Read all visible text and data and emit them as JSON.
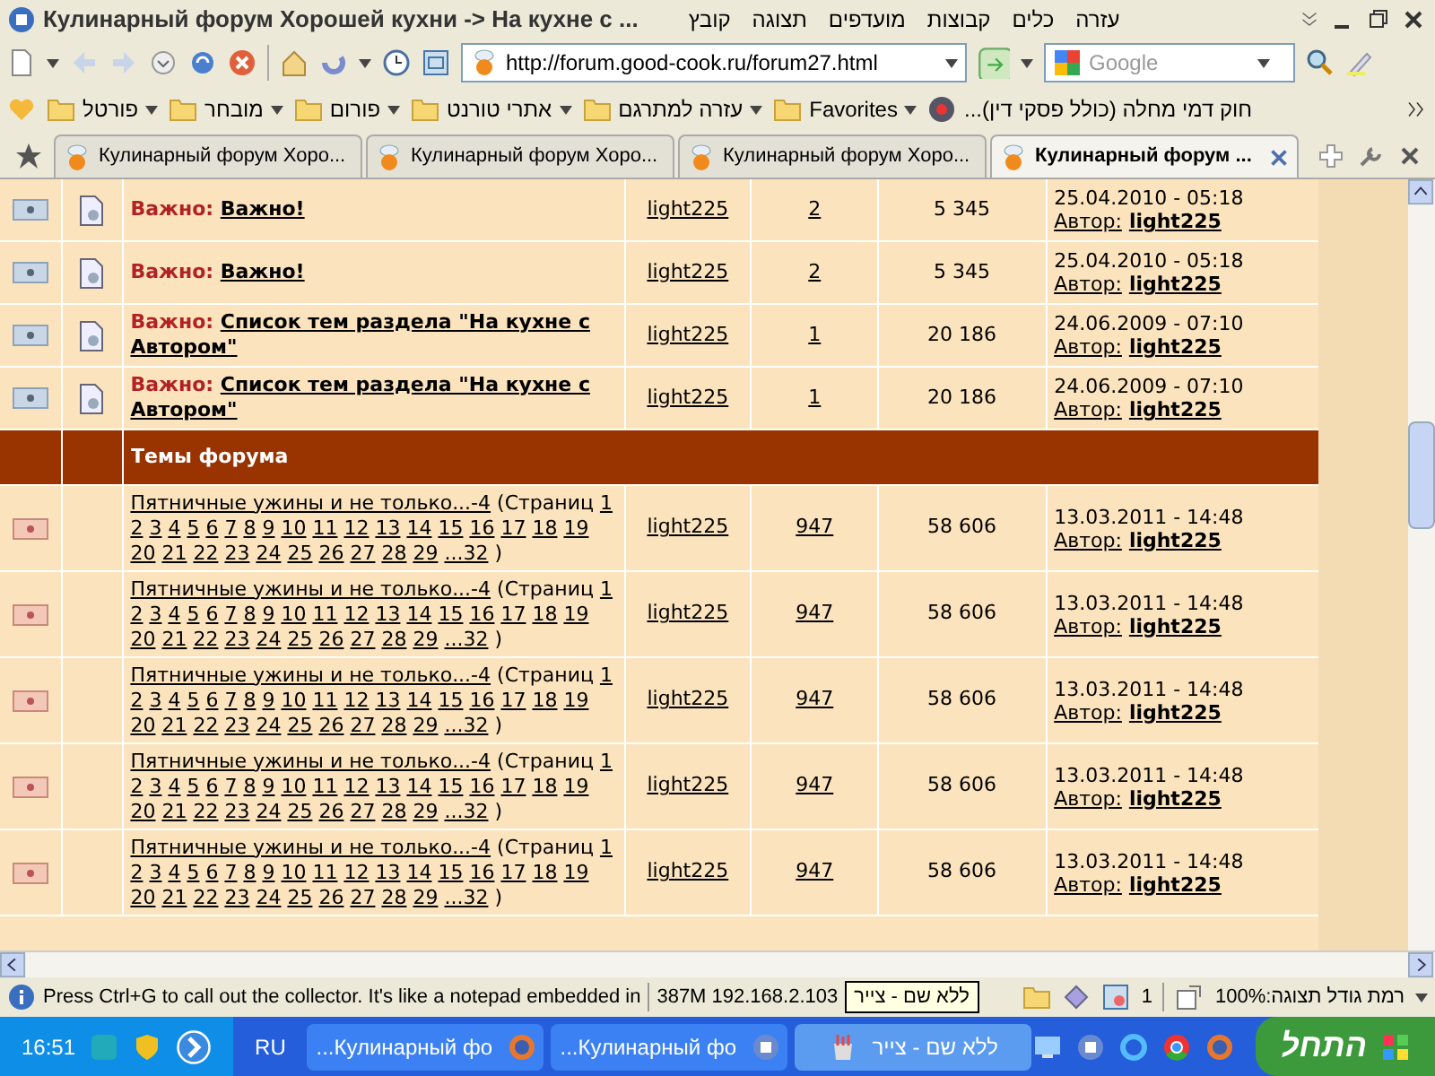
{
  "window": {
    "title": "Кулинарный форум Хорошей кухни -> На кухне с ..."
  },
  "menu": [
    "עזרה",
    "כלים",
    "קבוצות",
    "מועדפים",
    "תצוגה",
    "קובץ"
  ],
  "toolbar": {
    "address": "http://forum.good-cook.ru/forum27.html",
    "search_placeholder": "Google"
  },
  "bookmarks": [
    {
      "label": "...(חוק דמי מחלה (כולל פסקי דין",
      "kind": "link"
    },
    {
      "label": "Favorites",
      "kind": "folder"
    },
    {
      "label": "עזרה למתרגם",
      "kind": "folder"
    },
    {
      "label": "אתרי טורנט",
      "kind": "folder"
    },
    {
      "label": "פורום",
      "kind": "folder"
    },
    {
      "label": "מובחר",
      "kind": "folder"
    },
    {
      "label": "פורטל",
      "kind": "folder"
    }
  ],
  "tabs": [
    {
      "label": "Кулинарный форум Хоро...",
      "selected": false
    },
    {
      "label": "Кулинарный форум Хоро...",
      "selected": false
    },
    {
      "label": "Кулинарный форум Хоро...",
      "selected": false
    },
    {
      "label": "Кулинарный форум ...",
      "selected": true
    }
  ],
  "table": {
    "sticky_rows": [
      {
        "prefix": "Важно:",
        "title": "Важно!",
        "author": "light225",
        "replies": "2",
        "views": "5 345",
        "last_date": "25.04.2010 - 05:18",
        "last_label": "Автор:",
        "last_author": "light225"
      },
      {
        "prefix": "Важно:",
        "title": "Важно!",
        "author": "light225",
        "replies": "2",
        "views": "5 345",
        "last_date": "25.04.2010 - 05:18",
        "last_label": "Автор:",
        "last_author": "light225"
      },
      {
        "prefix": "Важно:",
        "title": "Список тем раздела \"На кухне с Автором\"",
        "author": "light225",
        "replies": "1",
        "views": "20 186",
        "last_date": "24.06.2009 - 07:10",
        "last_label": "Автор:",
        "last_author": "light225"
      },
      {
        "prefix": "Важно:",
        "title": "Список тем раздела \"На кухне с Автором\"",
        "author": "light225",
        "replies": "1",
        "views": "20 186",
        "last_date": "24.06.2009 - 07:10",
        "last_label": "Автор:",
        "last_author": "light225"
      }
    ],
    "section": "Темы форума",
    "topic_rows": [
      {
        "title": "Пятничные ужины и не только...-4",
        "pages_label": "(Страниц",
        "pages": [
          "1",
          "2",
          "3",
          "4",
          "5",
          "6",
          "7",
          "8",
          "9",
          "10",
          "11",
          "12",
          "13",
          "14",
          "15",
          "16",
          "17",
          "18",
          "19",
          "20",
          "21",
          "22",
          "23",
          "24",
          "25",
          "26",
          "27",
          "28",
          "29",
          "...32"
        ],
        "pages_end": ")",
        "author": "light225",
        "replies": "947",
        "views": "58 606",
        "last_date": "13.03.2011 - 14:48",
        "last_label": "Автор:",
        "last_author": "light225"
      },
      {
        "title": "Пятничные ужины и не только...-4",
        "pages_label": "(Страниц",
        "pages": [
          "1",
          "2",
          "3",
          "4",
          "5",
          "6",
          "7",
          "8",
          "9",
          "10",
          "11",
          "12",
          "13",
          "14",
          "15",
          "16",
          "17",
          "18",
          "19",
          "20",
          "21",
          "22",
          "23",
          "24",
          "25",
          "26",
          "27",
          "28",
          "29",
          "...32"
        ],
        "pages_end": ")",
        "author": "light225",
        "replies": "947",
        "views": "58 606",
        "last_date": "13.03.2011 - 14:48",
        "last_label": "Автор:",
        "last_author": "light225"
      },
      {
        "title": "Пятничные ужины и не только...-4",
        "pages_label": "(Страниц",
        "pages": [
          "1",
          "2",
          "3",
          "4",
          "5",
          "6",
          "7",
          "8",
          "9",
          "10",
          "11",
          "12",
          "13",
          "14",
          "15",
          "16",
          "17",
          "18",
          "19",
          "20",
          "21",
          "22",
          "23",
          "24",
          "25",
          "26",
          "27",
          "28",
          "29",
          "...32"
        ],
        "pages_end": ")",
        "author": "light225",
        "replies": "947",
        "views": "58 606",
        "last_date": "13.03.2011 - 14:48",
        "last_label": "Автор:",
        "last_author": "light225"
      },
      {
        "title": "Пятничные ужины и не только...-4",
        "pages_label": "(Страниц",
        "pages": [
          "1",
          "2",
          "3",
          "4",
          "5",
          "6",
          "7",
          "8",
          "9",
          "10",
          "11",
          "12",
          "13",
          "14",
          "15",
          "16",
          "17",
          "18",
          "19",
          "20",
          "21",
          "22",
          "23",
          "24",
          "25",
          "26",
          "27",
          "28",
          "29",
          "...32"
        ],
        "pages_end": ")",
        "author": "light225",
        "replies": "947",
        "views": "58 606",
        "last_date": "13.03.2011 - 14:48",
        "last_label": "Автор:",
        "last_author": "light225"
      },
      {
        "title": "Пятничные ужины и не только...-4",
        "pages_label": "(Страниц",
        "pages": [
          "1",
          "2",
          "3",
          "4",
          "5",
          "6",
          "7",
          "8",
          "9",
          "10",
          "11",
          "12",
          "13",
          "14",
          "15",
          "16",
          "17",
          "18",
          "19",
          "20",
          "21",
          "22",
          "23",
          "24",
          "25",
          "26",
          "27",
          "28",
          "29",
          "...32"
        ],
        "pages_end": ")",
        "author": "light225",
        "replies": "947",
        "views": "58 606",
        "last_date": "13.03.2011 - 14:48",
        "last_label": "Автор:",
        "last_author": "light225"
      }
    ]
  },
  "status_bar": {
    "message": "Press Ctrl+G to call out the collector. It's like a notepad embedded in",
    "memory": "387M 192.168.2.103",
    "tooltip": "ללא שם - צייר",
    "count": "1",
    "zoom": "רמת גודל תצוגה:100%"
  },
  "taskbar": {
    "clock": "16:51",
    "language": "RU",
    "tasks": [
      {
        "label": "...Кулинарный фо",
        "kind": "fox",
        "selected": false
      },
      {
        "label": "...Кулинарный фо",
        "kind": "browser",
        "selected": false
      },
      {
        "label": "ללא שם - צייר",
        "kind": "paint",
        "selected": true
      }
    ],
    "start": "התחל"
  }
}
